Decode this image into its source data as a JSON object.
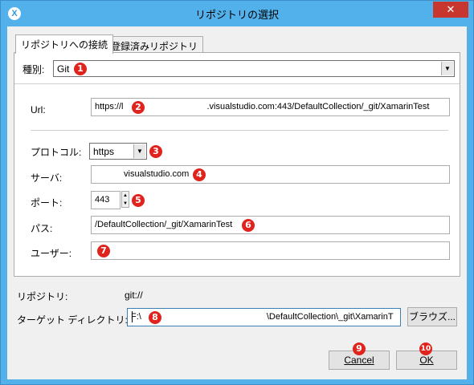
{
  "window": {
    "title": "リポジトリの選択",
    "app_icon": "X",
    "close_glyph": "✕"
  },
  "tabs": [
    {
      "label": "リポジトリへの接続",
      "active": true
    },
    {
      "label": "登録済みリポジトリ",
      "active": false
    }
  ],
  "form": {
    "kind_label": "種別:",
    "kind_value": "Git",
    "url_label": "Url:",
    "url_prefix": "https://l",
    "url_suffix": ".visualstudio.com:443/DefaultCollection/_git/XamarinTest",
    "protocol_label": "プロトコル:",
    "protocol_value": "https",
    "server_label": "サーバ:",
    "server_value": "visualstudio.com",
    "port_label": "ポート:",
    "port_value": "443",
    "path_label": "パス:",
    "path_value": "/DefaultCollection/_git/XamarinTest",
    "user_label": "ユーザー:",
    "user_value": ""
  },
  "repository": {
    "label": "リポジトリ:",
    "value": "git://"
  },
  "target_dir": {
    "label": "ターゲット ディレクトリ:",
    "value_prefix": "F:\\",
    "value_suffix": "\\DefaultCollection\\_git\\XamarinT",
    "browse_label": "ブラウズ..."
  },
  "buttons": {
    "cancel_label": "Cancel",
    "ok_label": "OK"
  },
  "badges": [
    "1",
    "2",
    "3",
    "4",
    "5",
    "6",
    "7",
    "8",
    "9",
    "10"
  ],
  "colors": {
    "titlebar": "#52b0ea",
    "close": "#c7372f",
    "badge": "#e0231c"
  }
}
